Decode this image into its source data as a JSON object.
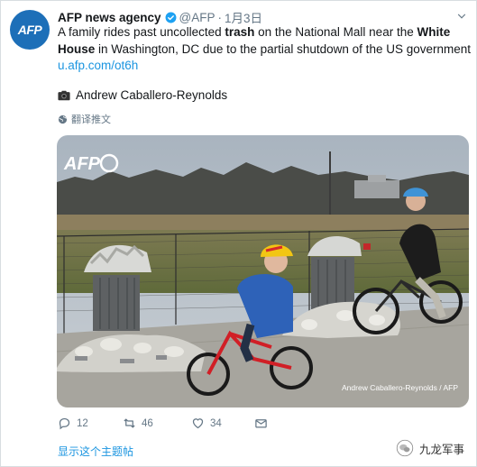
{
  "tweet": {
    "author_name": "AFP news agency",
    "handle": "@AFP",
    "separator": "·",
    "time": "1月3日",
    "text_parts": [
      "A family rides past uncollected ",
      "trash",
      " on the National Mall near the ",
      "White House",
      " in Washington, DC due to the partial shutdown of the US government"
    ],
    "link": "u.afp.com/ot6h",
    "photo_credit": "Andrew Caballero-Reynolds",
    "translate_label": "翻译推文"
  },
  "avatar": {
    "text": "AFP",
    "color": "#1d6fb8"
  },
  "photo": {
    "logo_text": "AFP",
    "caption": "Andrew Caballero-Reynolds / AFP"
  },
  "actions": {
    "reply_count": "12",
    "retweet_count": "46",
    "like_count": "34"
  },
  "footer": {
    "show_thread": "显示这个主题帖",
    "watermark_text": "九龙军事"
  },
  "colors": {
    "link": "#1b95e0",
    "muted": "#657786",
    "verified": "#1da1f2"
  }
}
